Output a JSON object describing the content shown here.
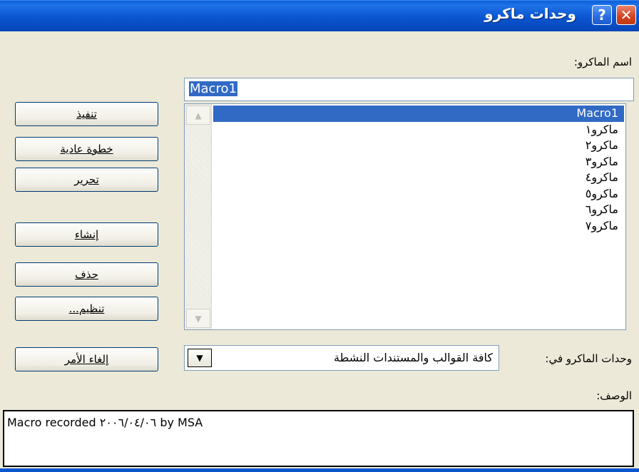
{
  "window": {
    "title": "وحدات ماكرو",
    "help_icon": "?",
    "close_icon": "✕"
  },
  "macro_name": {
    "label": "اسم الماكرو:",
    "value": "Macro1"
  },
  "macro_list": {
    "items": [
      "Macro1",
      "ماكرو١",
      "ماكرو٢",
      "ماكرو٣",
      "ماكرو٤",
      "ماكرو٥",
      "ماكرو٦",
      "ماكرو٧"
    ],
    "selected_index": 0
  },
  "buttons": {
    "run": "تنفيذ",
    "step_into": "خطوة عادية",
    "edit": "تحرير",
    "create": "إنشاء",
    "delete": "حذف",
    "organize": "تنظيم...",
    "cancel": "إلغاء الأمر"
  },
  "macros_in": {
    "label": "وحدات الماكرو في:",
    "value": "كافة القوالب والمستندات النشطة"
  },
  "description": {
    "label": "الوصف:",
    "text": "Macro recorded ٢٠٠٦/٠٤/٠٦ by MSA"
  }
}
